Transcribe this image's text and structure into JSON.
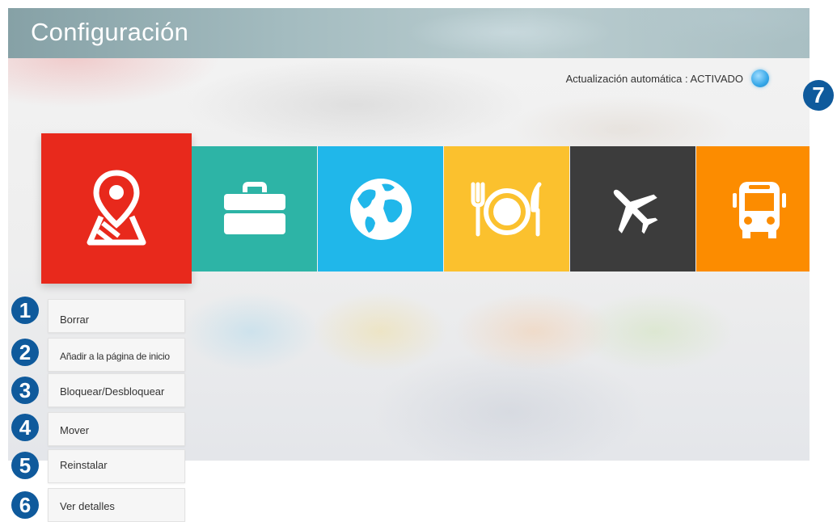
{
  "header": {
    "title": "Configuración"
  },
  "auto_update": {
    "label": "Actualización automática : ACTIVADO",
    "state": "on",
    "indicator_color": "#36a7e8"
  },
  "tiles": [
    {
      "id": "map",
      "icon": "map-pin-icon",
      "color": "#e8291c",
      "focused": true
    },
    {
      "id": "work",
      "icon": "briefcase-icon",
      "color": "#2db4a6"
    },
    {
      "id": "globe",
      "icon": "globe-icon",
      "color": "#20b7ea"
    },
    {
      "id": "food",
      "icon": "fork-plate-knife-icon",
      "color": "#fbc12e"
    },
    {
      "id": "flight",
      "icon": "airplane-icon",
      "color": "#3c3c3c"
    },
    {
      "id": "bus",
      "icon": "bus-icon",
      "color": "#fc8c00"
    }
  ],
  "context_menu": {
    "items": [
      {
        "label": "Borrar"
      },
      {
        "label": "Añadir a la página de inicio"
      },
      {
        "label": "Bloquear/Desbloquear"
      },
      {
        "label": "Mover"
      },
      {
        "label": "Reinstalar"
      },
      {
        "label": "Ver detalles"
      }
    ]
  },
  "callouts": [
    "1",
    "2",
    "3",
    "4",
    "5",
    "6",
    "7"
  ],
  "colors": {
    "callout": "#0f5a9c",
    "menu_bg": "#f6f6f6"
  }
}
